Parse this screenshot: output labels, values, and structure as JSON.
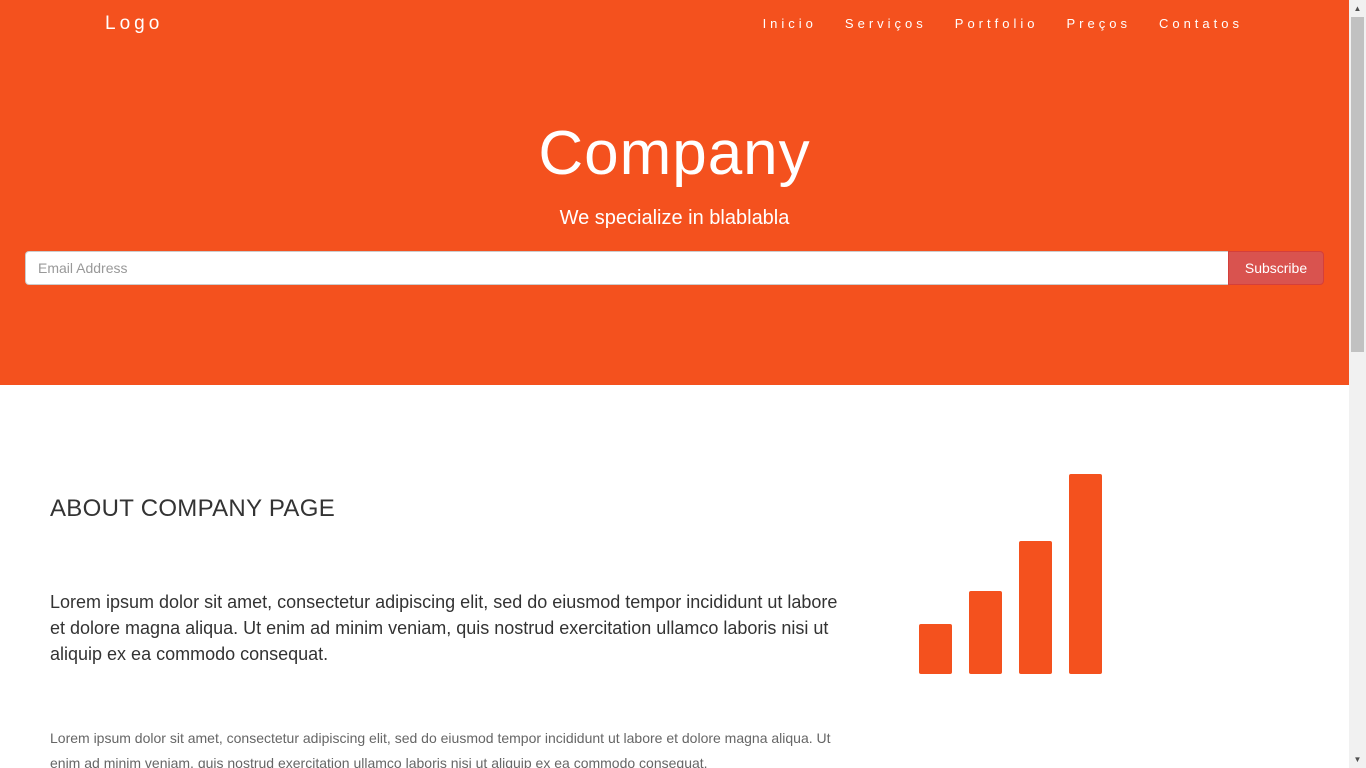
{
  "header": {
    "logo": "Logo",
    "nav": [
      "Inicio",
      "Serviços",
      "Portfolio",
      "Preços",
      "Contatos"
    ]
  },
  "hero": {
    "title": "Company",
    "subtitle": "We specialize in blablabla",
    "email_placeholder": "Email Address",
    "subscribe_label": "Subscribe"
  },
  "about": {
    "heading": "ABOUT COMPANY PAGE",
    "lead": "Lorem ipsum dolor sit amet, consectetur adipiscing elit, sed do eiusmod tempor incididunt ut labore et dolore magna aliqua. Ut enim ad minim veniam, quis nostrud exercitation ullamco laboris nisi ut aliquip ex ea commodo consequat.",
    "body": "Lorem ipsum dolor sit amet, consectetur adipiscing elit, sed do eiusmod tempor incididunt ut labore et dolore magna aliqua. Ut enim ad minim veniam, quis nostrud exercitation ullamco laboris nisi ut aliquip ex ea commodo consequat.",
    "graphic_icon": "signal-icon"
  },
  "colors": {
    "brand": "#f4511e",
    "button": "#d9534f",
    "heading": "#333333",
    "muted_text": "#666666"
  }
}
